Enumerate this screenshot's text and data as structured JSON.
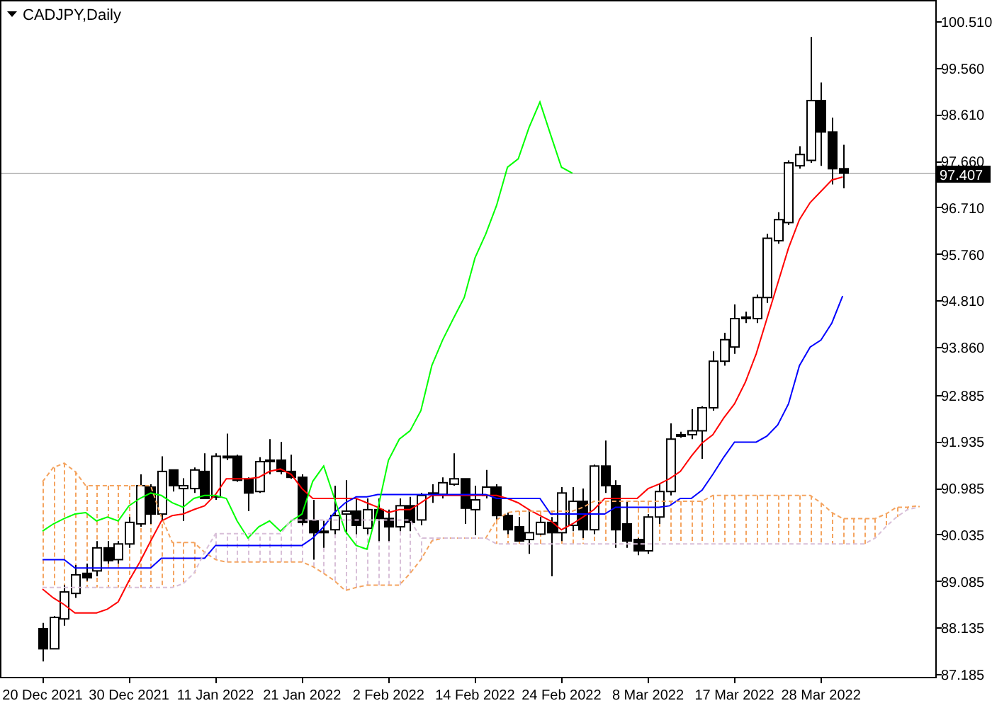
{
  "chart": {
    "chart_data": {
      "type": "candlestick",
      "title": "CADJPY,Daily",
      "categories": [
        "20 Dec 2021",
        null,
        null,
        null,
        null,
        null,
        null,
        null,
        "30 Dec 2021",
        null,
        null,
        null,
        null,
        null,
        null,
        null,
        "11 Jan 2022",
        null,
        null,
        null,
        null,
        null,
        null,
        null,
        "21 Jan 2022",
        null,
        null,
        null,
        null,
        null,
        null,
        null,
        "2 Feb 2022",
        null,
        null,
        null,
        null,
        null,
        null,
        null,
        "14 Feb 2022",
        null,
        null,
        null,
        null,
        null,
        null,
        null,
        "24 Feb 2022",
        null,
        null,
        null,
        null,
        null,
        null,
        null,
        "8 Mar 2022",
        null,
        null,
        null,
        null,
        null,
        null,
        null,
        "17 Mar 2022",
        null,
        null,
        null,
        null,
        null,
        null,
        null,
        "28 Mar 2022",
        null,
        null,
        null,
        null,
        null,
        null,
        null,
        null,
        null
      ],
      "ylim": [
        87.127,
        100.944
      ],
      "yticks": [
        {
          "value": 100.51,
          "label": "100.510"
        },
        {
          "value": 99.56,
          "label": "99.560"
        },
        {
          "value": 98.61,
          "label": "98.610"
        },
        {
          "value": 97.66,
          "label": "97.660"
        },
        {
          "value": 96.71,
          "label": "96.710"
        },
        {
          "value": 95.76,
          "label": "95.760"
        },
        {
          "value": 94.81,
          "label": "94.810"
        },
        {
          "value": 93.86,
          "label": "93.860"
        },
        {
          "value": 92.885,
          "label": "92.885"
        },
        {
          "value": 91.935,
          "label": "91.935"
        },
        {
          "value": 90.985,
          "label": "90.985"
        },
        {
          "value": 90.035,
          "label": "90.035"
        },
        {
          "value": 89.085,
          "label": "89.085"
        },
        {
          "value": 88.135,
          "label": "88.135"
        },
        {
          "value": 87.185,
          "label": "87.185"
        }
      ],
      "ohlc": [
        [
          88.11,
          88.23,
          87.44,
          87.7
        ],
        [
          87.7,
          88.37,
          87.7,
          88.34
        ],
        [
          88.31,
          89.0,
          88.17,
          88.86
        ],
        [
          88.83,
          89.41,
          88.74,
          89.21
        ],
        [
          89.24,
          89.44,
          89.09,
          89.15
        ],
        [
          89.29,
          89.9,
          89.18,
          89.76
        ],
        [
          89.76,
          89.9,
          89.44,
          89.5
        ],
        [
          89.52,
          89.9,
          89.44,
          89.84
        ],
        [
          89.84,
          90.39,
          89.76,
          90.28
        ],
        [
          90.25,
          91.26,
          90.19,
          91.03
        ],
        [
          91.0,
          91.06,
          90.25,
          90.45
        ],
        [
          90.45,
          91.63,
          90.31,
          91.32
        ],
        [
          91.35,
          91.35,
          90.91,
          91.03
        ],
        [
          90.97,
          91.18,
          90.31,
          91.03
        ],
        [
          90.97,
          91.4,
          90.88,
          91.35
        ],
        [
          91.32,
          91.69,
          90.77,
          90.77
        ],
        [
          90.8,
          91.69,
          90.74,
          91.63
        ],
        [
          91.63,
          92.09,
          91.55,
          91.61
        ],
        [
          91.63,
          91.66,
          91.11,
          91.14
        ],
        [
          91.17,
          91.2,
          90.51,
          90.88
        ],
        [
          90.91,
          91.61,
          90.88,
          91.52
        ],
        [
          91.55,
          91.98,
          91.26,
          91.55
        ],
        [
          91.55,
          91.92,
          91.26,
          91.32
        ],
        [
          91.32,
          91.66,
          91.17,
          91.2
        ],
        [
          91.2,
          91.26,
          90.22,
          90.28
        ],
        [
          90.31,
          90.74,
          89.52,
          90.07
        ],
        [
          90.1,
          90.31,
          89.76,
          90.1
        ],
        [
          90.13,
          91.03,
          90.04,
          90.42
        ],
        [
          90.45,
          91.14,
          90.04,
          90.51
        ],
        [
          90.51,
          90.77,
          90.04,
          90.22
        ],
        [
          90.16,
          90.77,
          90.04,
          90.54
        ],
        [
          90.54,
          90.77,
          89.9,
          90.36
        ],
        [
          90.36,
          90.54,
          89.9,
          90.19
        ],
        [
          90.19,
          90.77,
          90.1,
          90.62
        ],
        [
          90.62,
          90.8,
          90.1,
          90.28
        ],
        [
          90.33,
          90.88,
          90.22,
          90.83
        ],
        [
          90.88,
          91.06,
          90.68,
          90.88
        ],
        [
          90.85,
          91.2,
          90.77,
          91.09
        ],
        [
          91.06,
          91.69,
          91.03,
          91.17
        ],
        [
          91.17,
          91.17,
          90.25,
          90.57
        ],
        [
          90.54,
          91.03,
          90.02,
          90.74
        ],
        [
          90.83,
          91.35,
          90.77,
          91.0
        ],
        [
          91.0,
          91.06,
          90.33,
          90.42
        ],
        [
          90.42,
          90.48,
          90.04,
          90.13
        ],
        [
          90.19,
          90.39,
          89.9,
          89.9
        ],
        [
          89.93,
          90.54,
          89.64,
          90.07
        ],
        [
          90.04,
          90.39,
          90.02,
          90.28
        ],
        [
          90.28,
          90.39,
          89.18,
          90.07
        ],
        [
          90.07,
          91.0,
          89.9,
          90.88
        ],
        [
          90.22,
          91.0,
          90.1,
          90.71
        ],
        [
          90.71,
          90.97,
          89.96,
          90.13
        ],
        [
          90.13,
          91.46,
          90.04,
          91.43
        ],
        [
          91.43,
          91.95,
          90.88,
          91.03
        ],
        [
          91.03,
          91.14,
          89.76,
          90.13
        ],
        [
          90.25,
          90.71,
          89.76,
          89.9
        ],
        [
          89.93,
          89.96,
          89.61,
          89.7
        ],
        [
          89.7,
          90.45,
          89.64,
          90.39
        ],
        [
          90.39,
          91.06,
          90.25,
          90.91
        ],
        [
          90.91,
          92.3,
          90.83,
          91.98
        ],
        [
          92.07,
          92.13,
          92.01,
          92.07
        ],
        [
          92.07,
          92.59,
          91.98,
          92.15
        ],
        [
          92.15,
          92.65,
          91.58,
          92.62
        ],
        [
          92.62,
          93.77,
          92.56,
          93.57
        ],
        [
          93.57,
          94.15,
          93.48,
          94.01
        ],
        [
          93.86,
          94.73,
          93.72,
          94.44
        ],
        [
          94.47,
          94.58,
          94.35,
          94.47
        ],
        [
          94.44,
          94.93,
          94.35,
          94.87
        ],
        [
          94.87,
          96.17,
          94.76,
          96.08
        ],
        [
          96.03,
          96.61,
          95.97,
          96.46
        ],
        [
          96.4,
          97.67,
          96.35,
          97.62
        ],
        [
          97.56,
          97.96,
          97.5,
          97.79
        ],
        [
          97.67,
          100.19,
          97.62,
          98.89
        ],
        [
          98.89,
          99.26,
          97.56,
          98.25
        ],
        [
          98.25,
          98.54,
          97.18,
          97.5
        ],
        [
          97.5,
          97.99,
          97.1,
          97.41
        ],
        null,
        null,
        null,
        null,
        null,
        null,
        null
      ],
      "series": [
        {
          "type": "line",
          "color": "#ff0000",
          "values": [
            88.92,
            88.74,
            88.6,
            88.43,
            88.43,
            88.43,
            88.51,
            88.66,
            89.09,
            89.47,
            89.9,
            90.31,
            90.42,
            90.45,
            90.54,
            90.62,
            90.85,
            91.17,
            91.17,
            91.17,
            91.2,
            91.32,
            91.37,
            91.26,
            90.97,
            90.77,
            90.77,
            90.77,
            90.77,
            90.77,
            90.68,
            90.59,
            90.48,
            90.54,
            90.54,
            90.68,
            90.83,
            90.83,
            90.83,
            90.83,
            90.83,
            90.83,
            90.83,
            90.77,
            90.68,
            90.54,
            90.42,
            90.31,
            90.13,
            90.25,
            90.39,
            90.54,
            90.77,
            90.77,
            90.77,
            90.77,
            90.97,
            91.06,
            91.17,
            91.32,
            91.63,
            91.9,
            92.07,
            92.41,
            92.7,
            93.14,
            93.72,
            94.44,
            95.16,
            95.88,
            96.46,
            96.81,
            97.04,
            97.27,
            97.33,
            null,
            null,
            null,
            null,
            null,
            null,
            null
          ]
        },
        {
          "type": "line",
          "color": "#0000ff",
          "values": [
            89.52,
            89.52,
            89.52,
            89.35,
            89.35,
            89.35,
            89.35,
            89.35,
            89.35,
            89.35,
            89.35,
            89.55,
            89.55,
            89.55,
            89.55,
            89.55,
            89.81,
            89.81,
            89.81,
            89.81,
            89.81,
            89.81,
            89.81,
            89.81,
            89.81,
            89.96,
            90.19,
            90.48,
            90.68,
            90.8,
            90.8,
            90.85,
            90.85,
            90.85,
            90.85,
            90.85,
            90.85,
            90.85,
            90.85,
            90.85,
            90.85,
            90.85,
            90.77,
            90.77,
            90.77,
            90.77,
            90.77,
            90.45,
            90.45,
            90.45,
            90.45,
            90.45,
            90.45,
            90.59,
            90.59,
            90.59,
            90.59,
            90.59,
            90.62,
            90.77,
            90.77,
            90.94,
            91.26,
            91.61,
            91.92,
            91.92,
            91.92,
            92.04,
            92.27,
            92.7,
            93.48,
            93.86,
            94.0,
            94.35,
            94.9,
            null,
            null,
            null,
            null,
            null,
            null,
            null
          ]
        },
        {
          "type": "line",
          "color": "#00ff00",
          "values": [
            90.1,
            90.25,
            90.36,
            90.45,
            90.48,
            90.31,
            90.39,
            90.31,
            90.62,
            90.77,
            90.88,
            90.83,
            90.68,
            90.59,
            90.77,
            90.83,
            90.83,
            90.77,
            90.31,
            89.96,
            90.19,
            90.31,
            90.1,
            90.31,
            90.45,
            91.12,
            91.43,
            90.77,
            90.1,
            89.81,
            89.73,
            90.54,
            91.55,
            91.98,
            92.15,
            92.56,
            93.48,
            94.0,
            94.44,
            94.87,
            95.68,
            96.17,
            96.75,
            97.53,
            97.7,
            98.34,
            98.86,
            98.19,
            97.53,
            97.41,
            null,
            null,
            null,
            null,
            null,
            null,
            null,
            null,
            null,
            null,
            null,
            null,
            null,
            null,
            null,
            null,
            null,
            null,
            null,
            null,
            null,
            null,
            null,
            null,
            null,
            null,
            null,
            null,
            null,
            null,
            null,
            null
          ]
        },
        {
          "type": "line",
          "line_style": "dashed",
          "color": "#f4a460",
          "values": [
            91.11,
            91.4,
            91.49,
            91.32,
            91.03,
            91.03,
            91.03,
            91.03,
            91.03,
            91.03,
            91.03,
            90.39,
            89.87,
            89.87,
            89.87,
            89.67,
            89.52,
            89.47,
            89.47,
            89.47,
            89.47,
            89.47,
            89.47,
            89.47,
            89.47,
            89.38,
            89.24,
            89.09,
            88.89,
            88.95,
            89.0,
            89.0,
            89.0,
            89.0,
            89.24,
            89.52,
            89.9,
            89.96,
            89.96,
            89.96,
            89.96,
            89.96,
            90.33,
            90.48,
            90.51,
            90.51,
            90.51,
            90.51,
            90.51,
            90.51,
            90.59,
            90.71,
            90.71,
            90.71,
            90.71,
            90.71,
            90.71,
            90.71,
            90.71,
            90.71,
            90.71,
            90.71,
            90.83,
            90.83,
            90.83,
            90.83,
            90.83,
            90.83,
            90.83,
            90.83,
            90.83,
            90.83,
            90.68,
            90.48,
            90.36,
            90.36,
            90.36,
            90.36,
            90.45,
            90.59,
            90.59,
            90.62
          ]
        },
        {
          "type": "line",
          "line_style": "dashed",
          "color": "#d8bfd8",
          "values": [
            88.95,
            88.95,
            88.95,
            88.95,
            88.95,
            88.95,
            88.95,
            88.95,
            88.95,
            88.95,
            88.95,
            88.95,
            88.95,
            89.03,
            89.24,
            89.67,
            90.05,
            90.05,
            90.05,
            90.05,
            90.05,
            90.05,
            90.05,
            90.33,
            90.33,
            90.33,
            90.33,
            90.33,
            90.33,
            90.33,
            90.33,
            90.33,
            90.33,
            90.33,
            90.33,
            89.96,
            89.96,
            89.96,
            89.96,
            89.96,
            89.96,
            89.96,
            89.84,
            89.84,
            89.84,
            89.84,
            89.84,
            89.84,
            89.84,
            89.84,
            89.84,
            89.84,
            89.84,
            89.84,
            89.84,
            89.84,
            89.84,
            89.84,
            89.84,
            89.84,
            89.84,
            89.84,
            89.84,
            89.84,
            89.84,
            89.84,
            89.84,
            89.84,
            89.84,
            89.84,
            89.84,
            89.84,
            89.84,
            89.84,
            89.84,
            89.84,
            89.84,
            89.96,
            90.19,
            90.39,
            90.54,
            90.59
          ]
        }
      ],
      "ref_lines": [
        {
          "axis": "y",
          "value": 97.407,
          "label": "97.407"
        }
      ]
    }
  }
}
